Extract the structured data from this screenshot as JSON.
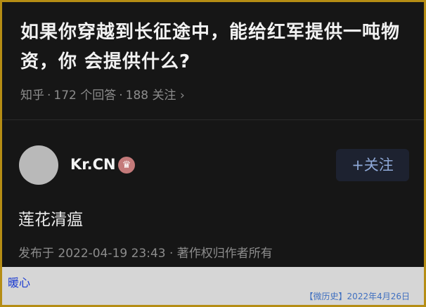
{
  "question": {
    "title": "如果你穿越到长征途中，能给红军提供一吨物资，你 会提供什么?"
  },
  "meta": {
    "source": "知乎",
    "answers": "172 个回答",
    "followers": "188 关注",
    "chevron": "›"
  },
  "answer": {
    "author": "Kr.CN",
    "badge_icon": "medal-icon",
    "badge_glyph": "♛",
    "follow_label": "+关注",
    "content": "莲花清瘟",
    "published": "发布于 2022-04-19 23:43 · 著作权归作者所有"
  },
  "caption": {
    "text": "暖心",
    "stamp": "【微历史】2022年4月26日"
  }
}
